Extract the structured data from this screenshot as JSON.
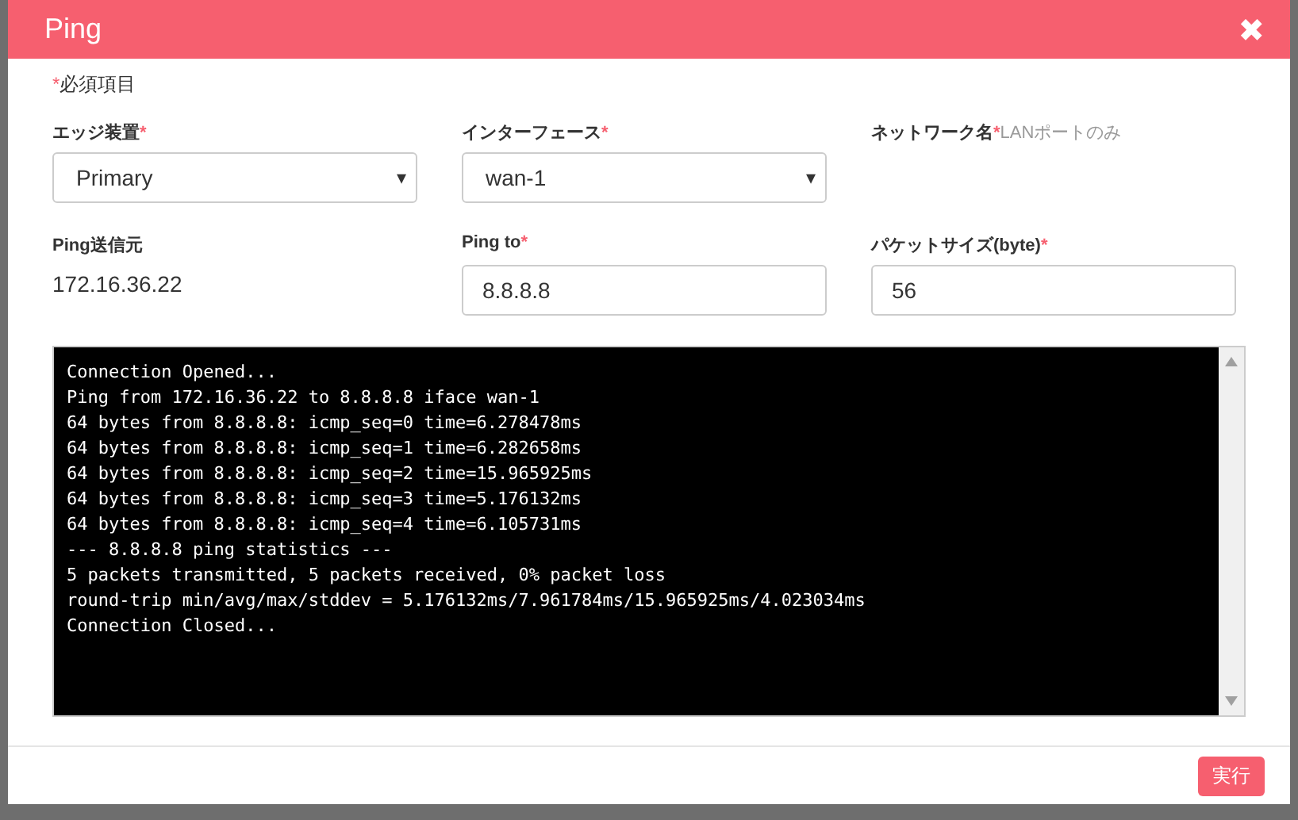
{
  "dialog": {
    "title": "Ping",
    "close": "✖"
  },
  "required_note": {
    "mark": "*",
    "text": "必須項目"
  },
  "fields": [
    {
      "kind": "select",
      "label": "エッジ装置",
      "mark": "*",
      "value": "Primary",
      "arrow": "▾"
    },
    {
      "kind": "select",
      "label": "インターフェース",
      "mark": "*",
      "value": "wan-1",
      "arrow": "▾"
    },
    {
      "kind": "note",
      "label": "ネットワーク名",
      "mark": "*",
      "note": "LANポートのみ"
    },
    {
      "kind": "static",
      "label": "Ping送信元",
      "value": "172.16.36.22"
    },
    {
      "kind": "input",
      "label": "Ping to",
      "mark": "*",
      "value": "8.8.8.8"
    },
    {
      "kind": "input",
      "label": "パケットサイズ(byte)",
      "mark": "*",
      "value": "56"
    }
  ],
  "console": [
    "Connection Opened...",
    "Ping from 172.16.36.22 to 8.8.8.8 iface wan-1",
    "64 bytes from 8.8.8.8: icmp_seq=0 time=6.278478ms",
    "64 bytes from 8.8.8.8: icmp_seq=1 time=6.282658ms",
    "64 bytes from 8.8.8.8: icmp_seq=2 time=15.965925ms",
    "64 bytes from 8.8.8.8: icmp_seq=3 time=5.176132ms",
    "64 bytes from 8.8.8.8: icmp_seq=4 time=6.105731ms",
    "--- 8.8.8.8 ping statistics ---",
    "5 packets transmitted, 5 packets received, 0% packet loss",
    "round-trip min/avg/max/stddev = 5.176132ms/7.961784ms/15.965925ms/4.023034ms",
    "Connection Closed..."
  ],
  "run_button": "実行"
}
